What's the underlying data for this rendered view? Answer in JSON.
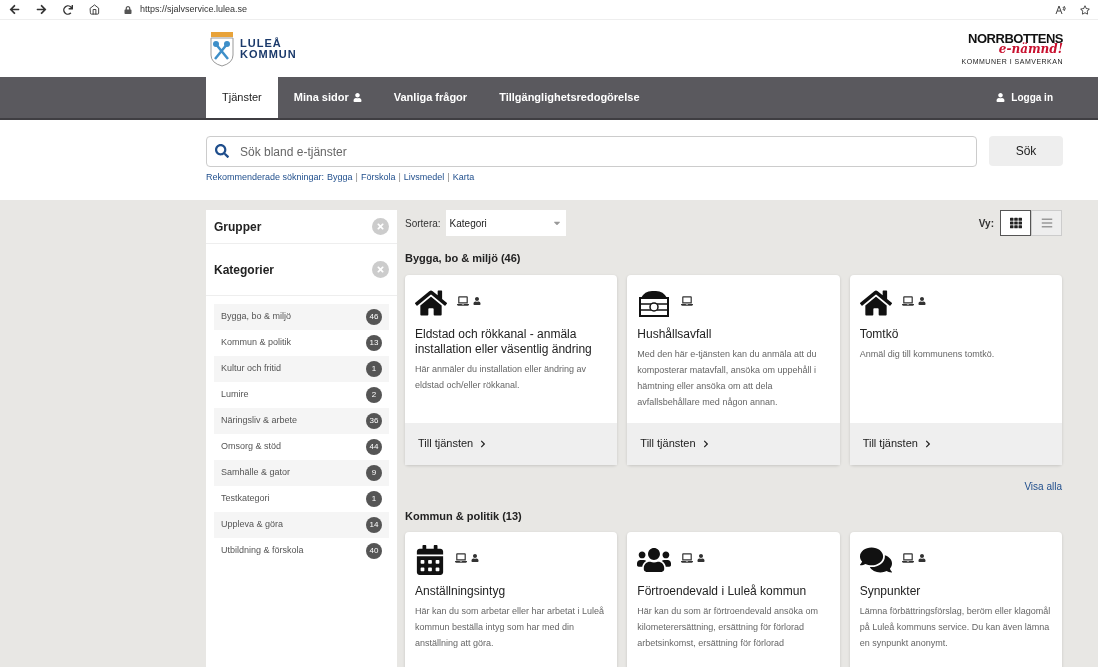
{
  "browser": {
    "url": "https://sjalvservice.lulea.se"
  },
  "header": {
    "logo_lines": [
      "LULEÅ",
      "KOMMUN"
    ],
    "partner_logo": {
      "line1": "NORRBOTTENS",
      "line2": "e-nämnd!",
      "line3": "KOMMUNER I SAMVERKAN"
    }
  },
  "nav": {
    "items": [
      {
        "label": "Tjänster",
        "selected": true,
        "user_icon": false
      },
      {
        "label": "Mina sidor",
        "selected": false,
        "user_icon": true
      },
      {
        "label": "Vanliga frågor",
        "selected": false,
        "user_icon": false
      },
      {
        "label": "Tillgänglighetsredogörelse",
        "selected": false,
        "user_icon": false
      }
    ],
    "login": "Logga in"
  },
  "search": {
    "placeholder": "Sök bland e-tjänster",
    "button": "Sök",
    "recommended_label": "Rekommenderade sökningar:",
    "recommended": [
      "Bygga",
      "Förskola",
      "Livsmedel",
      "Karta"
    ],
    "separator": "|"
  },
  "sidebar": {
    "groups_title": "Grupper",
    "categories_title": "Kategorier",
    "categories": [
      {
        "label": "Bygga, bo & miljö",
        "count": "46"
      },
      {
        "label": "Kommun & politik",
        "count": "13"
      },
      {
        "label": "Kultur och fritid",
        "count": "1"
      },
      {
        "label": "Lumire",
        "count": "2"
      },
      {
        "label": "Näringsliv & arbete",
        "count": "36"
      },
      {
        "label": "Omsorg & stöd",
        "count": "44"
      },
      {
        "label": "Samhälle & gator",
        "count": "9"
      },
      {
        "label": "Testkategori",
        "count": "1"
      },
      {
        "label": "Uppleva & göra",
        "count": "14"
      },
      {
        "label": "Utbildning & förskola",
        "count": "40"
      }
    ]
  },
  "toolbar": {
    "sort_label": "Sortera:",
    "sort_value": "Kategori",
    "view_label": "Vy:",
    "views": [
      {
        "kind": "grid",
        "selected": true
      },
      {
        "kind": "list",
        "selected": false
      }
    ]
  },
  "sections": [
    {
      "title": "Bygga, bo & miljö (46)",
      "show_all": "Visa alla",
      "cards": [
        {
          "kind": "house",
          "online": true,
          "login": true,
          "title": "Eldstad och rökkanal - anmäla installation eller väsentlig ändring",
          "description": "Här anmäler du installation eller ändring av eldstad och/eller rökkanal.",
          "link": "Till tjänsten"
        },
        {
          "kind": "bin",
          "online": true,
          "login": false,
          "title": "Hushållsavfall",
          "description": "Med den här e-tjänsten kan du anmäla att du komposterar matavfall, ansöka om uppehåll i hämtning eller ansöka om att dela avfallsbehållare med någon annan.",
          "link": "Till tjänsten"
        },
        {
          "kind": "house",
          "online": true,
          "login": true,
          "title": "Tomtkö",
          "description": "Anmäl dig till kommunens tomtkö.",
          "link": "Till tjänsten"
        }
      ]
    },
    {
      "title": "Kommun & politik (13)",
      "cards": [
        {
          "kind": "calendar",
          "online": true,
          "login": true,
          "title": "Anställningsintyg",
          "description": "Här kan du som arbetar eller har arbetat i Luleå kommun beställa intyg som har med din anställning att göra."
        },
        {
          "kind": "people",
          "online": true,
          "login": true,
          "title": "Förtroendevald i Luleå kommun",
          "description": "Här kan du som är förtroendevald ansöka om kilometerersättning, ersättning för förlorad arbetsinkomst, ersättning för förlorad"
        },
        {
          "kind": "speech",
          "online": true,
          "login": true,
          "title": "Synpunkter",
          "description": "Lämna förbättringsförslag, beröm eller klagomål på Luleå kommuns service. Du kan även lämna en synpunkt anonymt."
        }
      ]
    }
  ]
}
